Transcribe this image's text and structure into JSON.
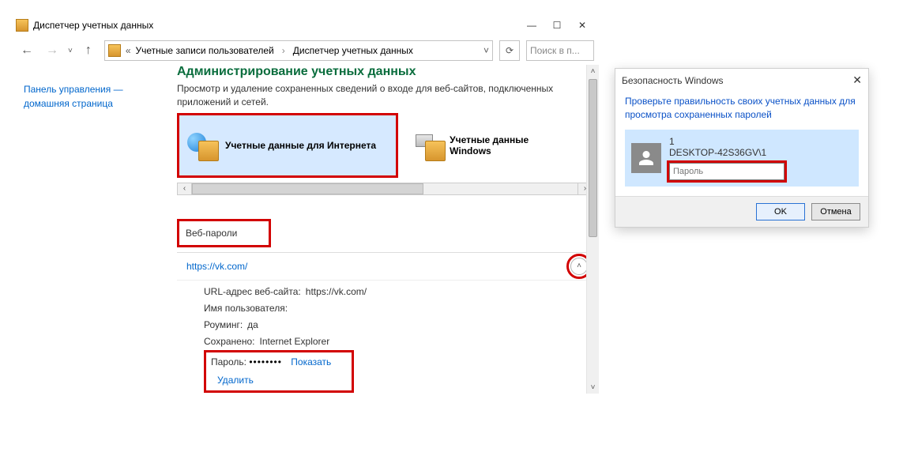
{
  "window": {
    "title": "Диспетчер учетных данных",
    "breadcrumb": {
      "segment1": "Учетные записи пользователей",
      "segment2": "Диспетчер учетных данных"
    },
    "search_placeholder": "Поиск в п..."
  },
  "sidebar": {
    "line1": "Панель управления —",
    "line2": "домашняя страница"
  },
  "page": {
    "heading": "Администрирование учетных данных",
    "subtitle": "Просмотр и удаление сохраненных сведений о входе для веб-сайтов, подключенных приложений и сетей.",
    "tile_web": "Учетные данные для Интернета",
    "tile_win": "Учетные данные Windows",
    "section_header": "Веб-пароли"
  },
  "entry": {
    "title": "https://vk.com/",
    "url_label": "URL-адрес веб-сайта:",
    "url_value": "https://vk.com/",
    "user_label": "Имя пользователя:",
    "user_value": "",
    "roaming_label": "Роуминг:",
    "roaming_value": "да",
    "saved_label": "Сохранено:",
    "saved_value": "Internet Explorer",
    "password_label": "Пароль:",
    "password_mask": "••••••••",
    "show": "Показать",
    "delete": "Удалить"
  },
  "dialog": {
    "title": "Безопасность Windows",
    "message": "Проверьте правильность своих учетных данных для просмотра сохраненных паролей",
    "user_index": "1",
    "username": "DESKTOP-42S36GV\\1",
    "password_placeholder": "Пароль",
    "ok": "OK",
    "cancel": "Отмена"
  }
}
